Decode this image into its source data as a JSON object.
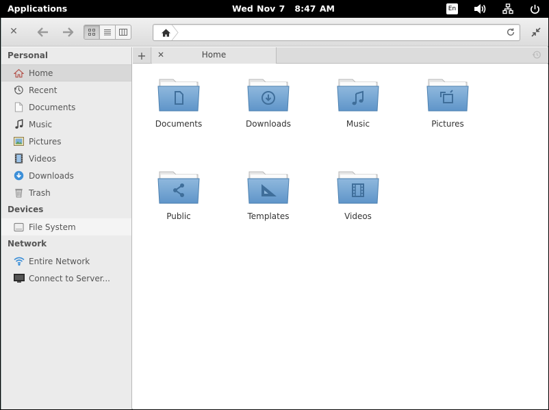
{
  "panel": {
    "applications": "Applications",
    "date": "Wed Nov  7",
    "time": "8:47 AM",
    "keyboard_layout": "En",
    "indicators": [
      "keyboard-icon",
      "volume-icon",
      "network-icon",
      "power-icon"
    ]
  },
  "toolbar": {
    "view_modes": [
      "icon-view",
      "list-view",
      "column-view"
    ],
    "active_view": "icon-view",
    "path": ""
  },
  "sidebar": {
    "sections": [
      {
        "title": "Personal",
        "items": [
          {
            "label": "Home",
            "icon": "home-icon",
            "selected": true
          },
          {
            "label": "Recent",
            "icon": "recent-icon"
          },
          {
            "label": "Documents",
            "icon": "document-icon"
          },
          {
            "label": "Music",
            "icon": "music-icon"
          },
          {
            "label": "Pictures",
            "icon": "pictures-icon"
          },
          {
            "label": "Videos",
            "icon": "videos-icon"
          },
          {
            "label": "Downloads",
            "icon": "downloads-icon"
          },
          {
            "label": "Trash",
            "icon": "trash-icon"
          }
        ]
      },
      {
        "title": "Devices",
        "items": [
          {
            "label": "File System",
            "icon": "drive-icon"
          }
        ]
      },
      {
        "title": "Network",
        "items": [
          {
            "label": "Entire Network",
            "icon": "wifi-icon"
          },
          {
            "label": "Connect to Server...",
            "icon": "monitor-icon"
          }
        ]
      }
    ]
  },
  "tabs": [
    {
      "label": "Home"
    }
  ],
  "folders": [
    {
      "label": "Documents",
      "emblem": "document"
    },
    {
      "label": "Downloads",
      "emblem": "download"
    },
    {
      "label": "Music",
      "emblem": "music"
    },
    {
      "label": "Pictures",
      "emblem": "pictures"
    },
    {
      "label": "Public",
      "emblem": "share"
    },
    {
      "label": "Templates",
      "emblem": "templates"
    },
    {
      "label": "Videos",
      "emblem": "video"
    }
  ],
  "colors": {
    "folder_top": "#8fb8dd",
    "folder_bottom": "#5f95c9",
    "accent_blue": "#3c8fd8"
  }
}
